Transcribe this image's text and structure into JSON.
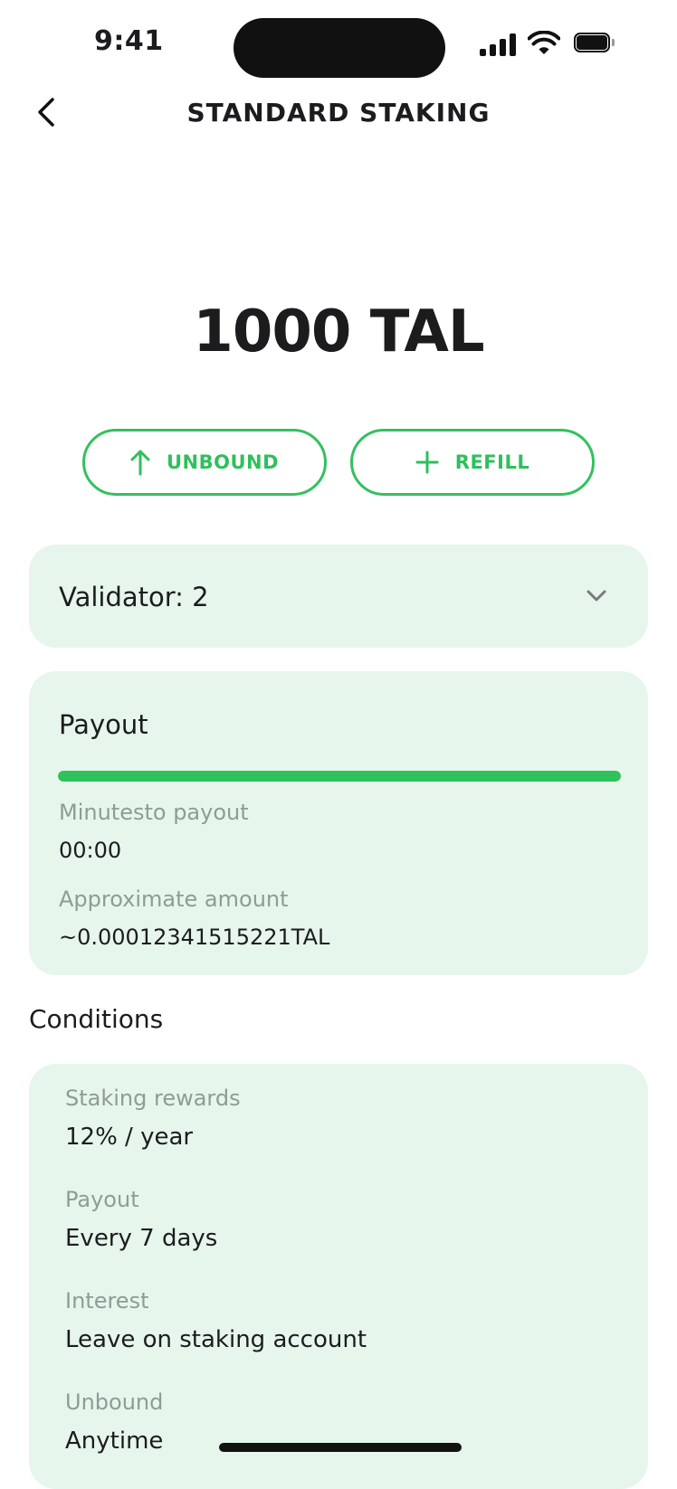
{
  "status_bar": {
    "time": "9:41"
  },
  "header": {
    "title": "STANDARD STAKING",
    "back_icon": "chevron-left-icon"
  },
  "balance": {
    "amount": "1000 TAL"
  },
  "actions": {
    "unbound_label": "UNBOUND",
    "unbound_icon": "arrow-up-icon",
    "refill_label": "REFILL",
    "refill_icon": "plus-icon",
    "accent_color": "#33c15f"
  },
  "validator": {
    "label": "Validator: 2",
    "icon": "chevron-down-icon"
  },
  "payout": {
    "title": "Payout",
    "progress_fraction": 1.0,
    "minutes_label": "Minutesto payout",
    "minutes_value": "00:00",
    "amount_label": "Approximate amount",
    "amount_value": "~0.00012341515221TAL"
  },
  "conditions": {
    "title": "Conditions",
    "items": [
      {
        "label": "Staking rewards",
        "value": "12% / year"
      },
      {
        "label": "Payout",
        "value": "Every 7 days"
      },
      {
        "label": "Interest",
        "value": "Leave on staking account"
      },
      {
        "label": "Unbound",
        "value": "Anytime"
      }
    ]
  },
  "colors": {
    "card_background": "#e6f6ec",
    "progress_bar": "#2fc25a"
  }
}
